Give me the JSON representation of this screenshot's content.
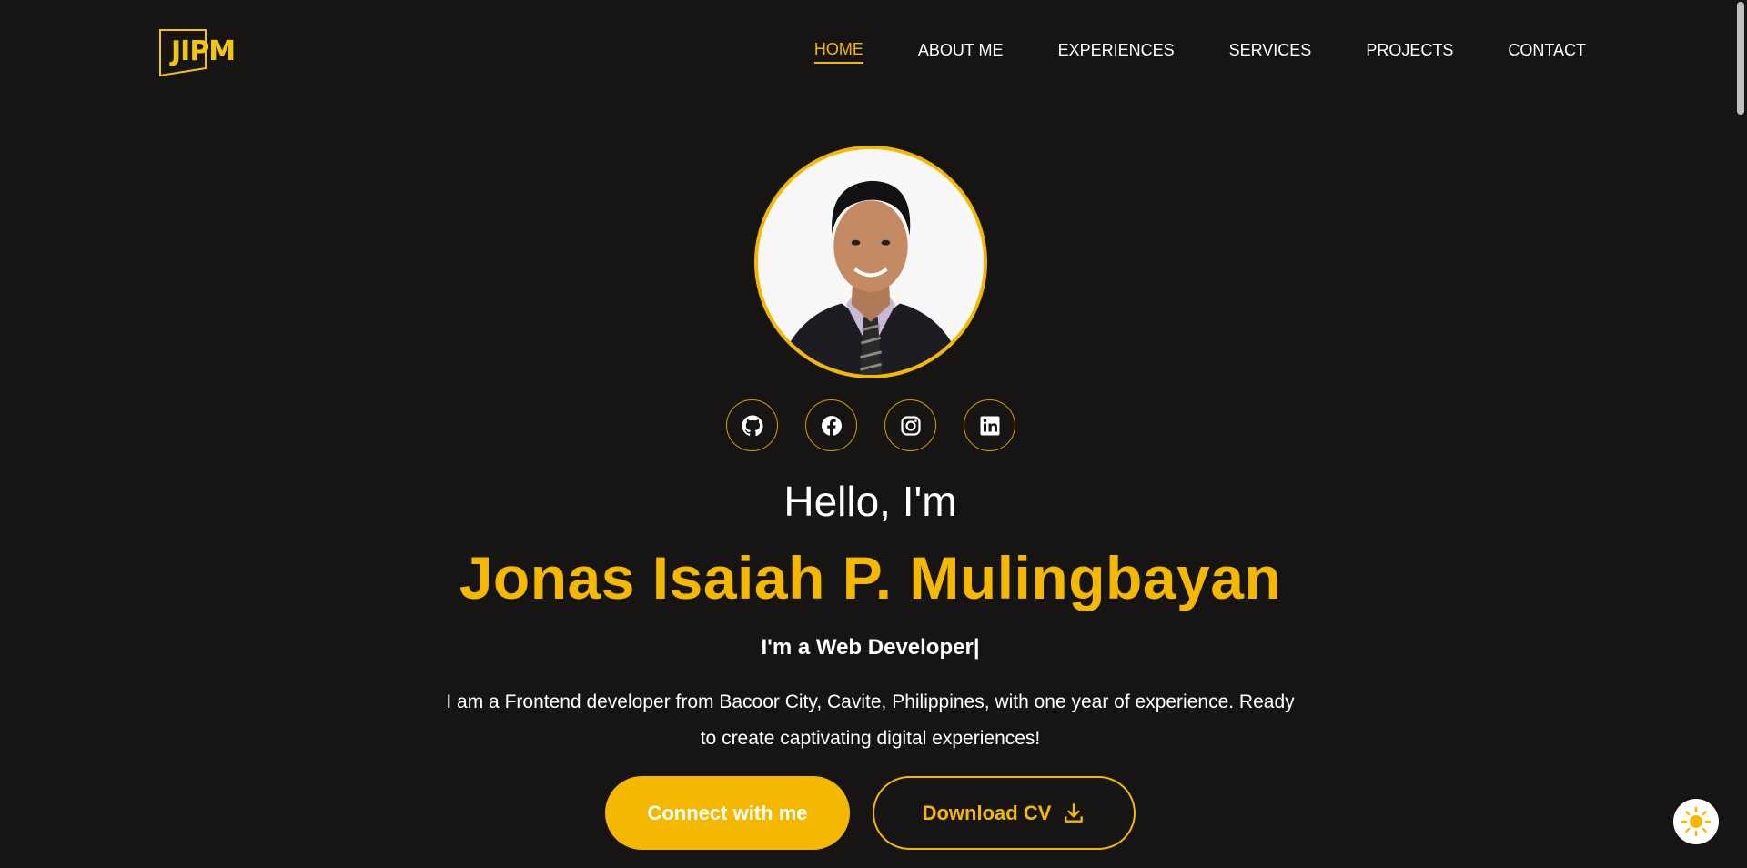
{
  "brand": {
    "logo_text": "JIPM",
    "accent": "#f5b800"
  },
  "nav": {
    "items": [
      {
        "label": "HOME",
        "active": true
      },
      {
        "label": "ABOUT ME",
        "active": false
      },
      {
        "label": "EXPERIENCES",
        "active": false
      },
      {
        "label": "SERVICES",
        "active": false
      },
      {
        "label": "PROJECTS",
        "active": false
      },
      {
        "label": "CONTACT",
        "active": false
      }
    ]
  },
  "hero": {
    "greeting": "Hello, I'm",
    "name": "Jonas Isaiah P. Mulingbayan",
    "role": "I'm a Web Developer|",
    "bio": "I am a Frontend developer from Bacoor City, Cavite, Philippines, with one year of experience. Ready to create captivating digital experiences!",
    "socials": [
      "github-icon",
      "facebook-icon",
      "instagram-icon",
      "linkedin-icon"
    ],
    "primary_button": "Connect with me",
    "secondary_button": "Download CV"
  },
  "theme_toggle": {
    "icon": "sun-icon"
  }
}
